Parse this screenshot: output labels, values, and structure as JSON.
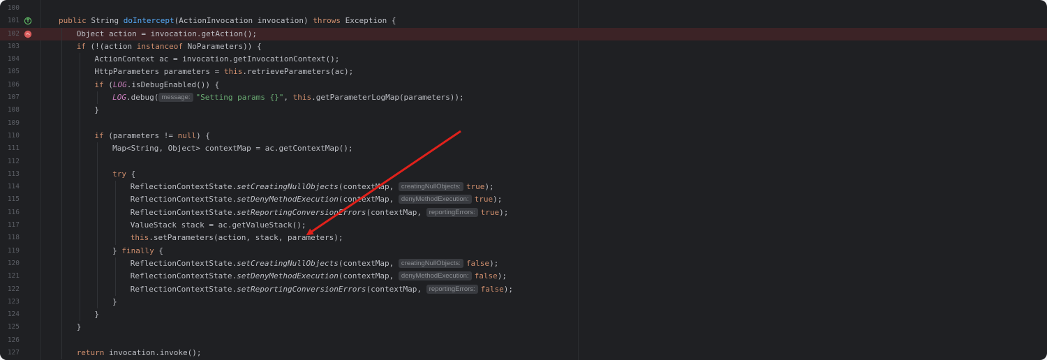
{
  "editor": {
    "lines": [
      {
        "num": "100",
        "tokens": []
      },
      {
        "num": "101",
        "tokens": [
          {
            "t": "public String ",
            "c": "kw0"
          },
          {
            "t": "doIntercept",
            "c": "fn"
          },
          {
            "t": "(ActionInvocation invocation) "
          },
          {
            "t": "throws",
            "c": "kw"
          },
          {
            "t": " Exception {"
          }
        ],
        "indent": 0,
        "icon": "override-icon"
      },
      {
        "num": "102",
        "tokens": [
          {
            "t": "Object action = invocation.getAction();"
          }
        ],
        "indent": 1,
        "breakpoint": true
      },
      {
        "num": "103",
        "tokens": [
          {
            "t": "if",
            "c": "kw"
          },
          {
            "t": " (!(action "
          },
          {
            "t": "instanceof",
            "c": "kw"
          },
          {
            "t": " NoParameters)) {"
          }
        ],
        "indent": 1
      },
      {
        "num": "104",
        "tokens": [
          {
            "t": "ActionContext ac = invocation.getInvocationContext();"
          }
        ],
        "indent": 2
      },
      {
        "num": "105",
        "tokens": [
          {
            "t": "HttpParameters parameters = "
          },
          {
            "t": "this",
            "c": "kw"
          },
          {
            "t": ".retrieveParameters(ac);"
          }
        ],
        "indent": 2
      },
      {
        "num": "106",
        "tokens": [
          {
            "t": "if",
            "c": "kw"
          },
          {
            "t": " ("
          },
          {
            "t": "LOG",
            "c": "fi"
          },
          {
            "t": ".isDebugEnabled()) {"
          }
        ],
        "indent": 2
      },
      {
        "num": "107",
        "tokens": [
          {
            "t": "LOG",
            "c": "fi"
          },
          {
            "t": ".debug("
          },
          {
            "t": "message:",
            "c": "hint"
          },
          {
            "t": "\"Setting params {}\"",
            "c": "st"
          },
          {
            "t": ", "
          },
          {
            "t": "this",
            "c": "kw"
          },
          {
            "t": ".getParameterLogMap(parameters));"
          }
        ],
        "indent": 3
      },
      {
        "num": "108",
        "tokens": [
          {
            "t": "}"
          }
        ],
        "indent": 2
      },
      {
        "num": "109",
        "tokens": []
      },
      {
        "num": "110",
        "tokens": [
          {
            "t": "if",
            "c": "kw"
          },
          {
            "t": " (parameters != "
          },
          {
            "t": "null",
            "c": "kw"
          },
          {
            "t": ") {"
          }
        ],
        "indent": 2
      },
      {
        "num": "111",
        "tokens": [
          {
            "t": "Map<String, Object> contextMap = ac.getContextMap();"
          }
        ],
        "indent": 3
      },
      {
        "num": "112",
        "tokens": []
      },
      {
        "num": "113",
        "tokens": [
          {
            "t": "try",
            "c": "kw"
          },
          {
            "t": " {"
          }
        ],
        "indent": 3
      },
      {
        "num": "114",
        "tokens": [
          {
            "t": "ReflectionContextState."
          },
          {
            "t": "setCreatingNullObjects",
            "c": "it"
          },
          {
            "t": "(contextMap, "
          },
          {
            "t": "creatingNullObjects:",
            "c": "hint"
          },
          {
            "t": "true",
            "c": "kw"
          },
          {
            "t": ");"
          }
        ],
        "indent": 4
      },
      {
        "num": "115",
        "tokens": [
          {
            "t": "ReflectionContextState."
          },
          {
            "t": "setDenyMethodExecution",
            "c": "it"
          },
          {
            "t": "(contextMap, "
          },
          {
            "t": "denyMethodExecution:",
            "c": "hint"
          },
          {
            "t": "true",
            "c": "kw"
          },
          {
            "t": ");"
          }
        ],
        "indent": 4
      },
      {
        "num": "116",
        "tokens": [
          {
            "t": "ReflectionContextState."
          },
          {
            "t": "setReportingConversionErrors",
            "c": "it"
          },
          {
            "t": "(contextMap, "
          },
          {
            "t": "reportingErrors:",
            "c": "hint"
          },
          {
            "t": "true",
            "c": "kw"
          },
          {
            "t": ");"
          }
        ],
        "indent": 4
      },
      {
        "num": "117",
        "tokens": [
          {
            "t": "ValueStack stack = ac.getValueStack();"
          }
        ],
        "indent": 4
      },
      {
        "num": "118",
        "tokens": [
          {
            "t": "this",
            "c": "kw"
          },
          {
            "t": ".setParameters(action, stack, parameters);"
          }
        ],
        "indent": 4
      },
      {
        "num": "119",
        "tokens": [
          {
            "t": "} "
          },
          {
            "t": "finally",
            "c": "kw"
          },
          {
            "t": " {"
          }
        ],
        "indent": 3
      },
      {
        "num": "120",
        "tokens": [
          {
            "t": "ReflectionContextState."
          },
          {
            "t": "setCreatingNullObjects",
            "c": "it"
          },
          {
            "t": "(contextMap, "
          },
          {
            "t": "creatingNullObjects:",
            "c": "hint"
          },
          {
            "t": "false",
            "c": "kw"
          },
          {
            "t": ");"
          }
        ],
        "indent": 4
      },
      {
        "num": "121",
        "tokens": [
          {
            "t": "ReflectionContextState."
          },
          {
            "t": "setDenyMethodExecution",
            "c": "it"
          },
          {
            "t": "(contextMap, "
          },
          {
            "t": "denyMethodExecution:",
            "c": "hint"
          },
          {
            "t": "false",
            "c": "kw"
          },
          {
            "t": ");"
          }
        ],
        "indent": 4
      },
      {
        "num": "122",
        "tokens": [
          {
            "t": "ReflectionContextState."
          },
          {
            "t": "setReportingConversionErrors",
            "c": "it"
          },
          {
            "t": "(contextMap, "
          },
          {
            "t": "reportingErrors:",
            "c": "hint"
          },
          {
            "t": "false",
            "c": "kw"
          },
          {
            "t": ");"
          }
        ],
        "indent": 4
      },
      {
        "num": "123",
        "tokens": [
          {
            "t": "}"
          }
        ],
        "indent": 3
      },
      {
        "num": "124",
        "tokens": [
          {
            "t": "}"
          }
        ],
        "indent": 2
      },
      {
        "num": "125",
        "tokens": [
          {
            "t": "}"
          }
        ],
        "indent": 1
      },
      {
        "num": "126",
        "tokens": []
      },
      {
        "num": "127",
        "tokens": [
          {
            "t": "return",
            "c": "kw"
          },
          {
            "t": " invocation.invoke();"
          }
        ],
        "indent": 1
      }
    ]
  },
  "colors": {
    "background": "#1f2023",
    "breakpoint_line": "#3c2326",
    "breakpoint_dot": "#db5c5c",
    "arrow": "#e0211b",
    "keyword": "#cf8e6d",
    "method": "#56a8f5",
    "string": "#6aab73"
  },
  "annotation": {
    "type": "arrow",
    "points_to": "this.setParameters(action, stack, parameters);"
  }
}
